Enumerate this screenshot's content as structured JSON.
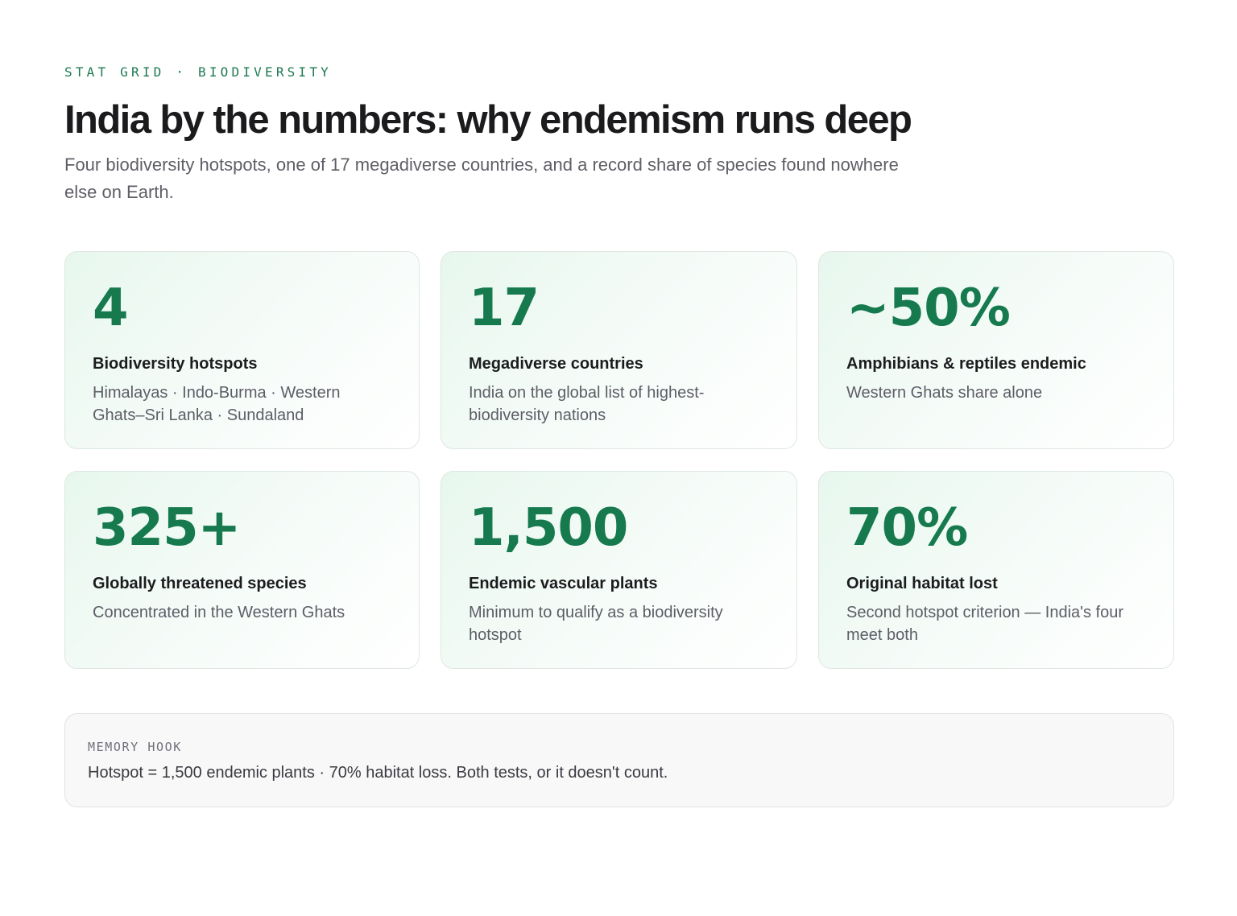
{
  "header": {
    "eyebrow": "STAT GRID · BIODIVERSITY",
    "title": "India by the numbers: why endemism runs deep",
    "subtitle": "Four biodiversity hotspots, one of 17 megadiverse countries, and a record share of species found nowhere else on Earth."
  },
  "stats": [
    {
      "value": "4",
      "label": "Biodiversity hotspots",
      "desc": "Himalayas · Indo-Burma · Western Ghats–Sri Lanka · Sundaland"
    },
    {
      "value": "17",
      "label": "Megadiverse countries",
      "desc": "India on the global list of highest-biodiversity nations"
    },
    {
      "value": "~50%",
      "label": "Amphibians & reptiles endemic",
      "desc": "Western Ghats share alone"
    },
    {
      "value": "325+",
      "label": "Globally threatened species",
      "desc": "Concentrated in the Western Ghats"
    },
    {
      "value": "1,500",
      "label": "Endemic vascular plants",
      "desc": "Minimum to qualify as a biodiversity hotspot"
    },
    {
      "value": "70%",
      "label": "Original habitat lost",
      "desc": "Second hotspot criterion — India's four meet both"
    }
  ],
  "memory_hook": {
    "label": "MEMORY HOOK",
    "text": "Hotspot = 1,500 endemic plants · 70% habitat loss. Both tests, or it doesn't count."
  },
  "colors": {
    "accent": "#167a4e",
    "eyebrow": "#1e7a52"
  }
}
